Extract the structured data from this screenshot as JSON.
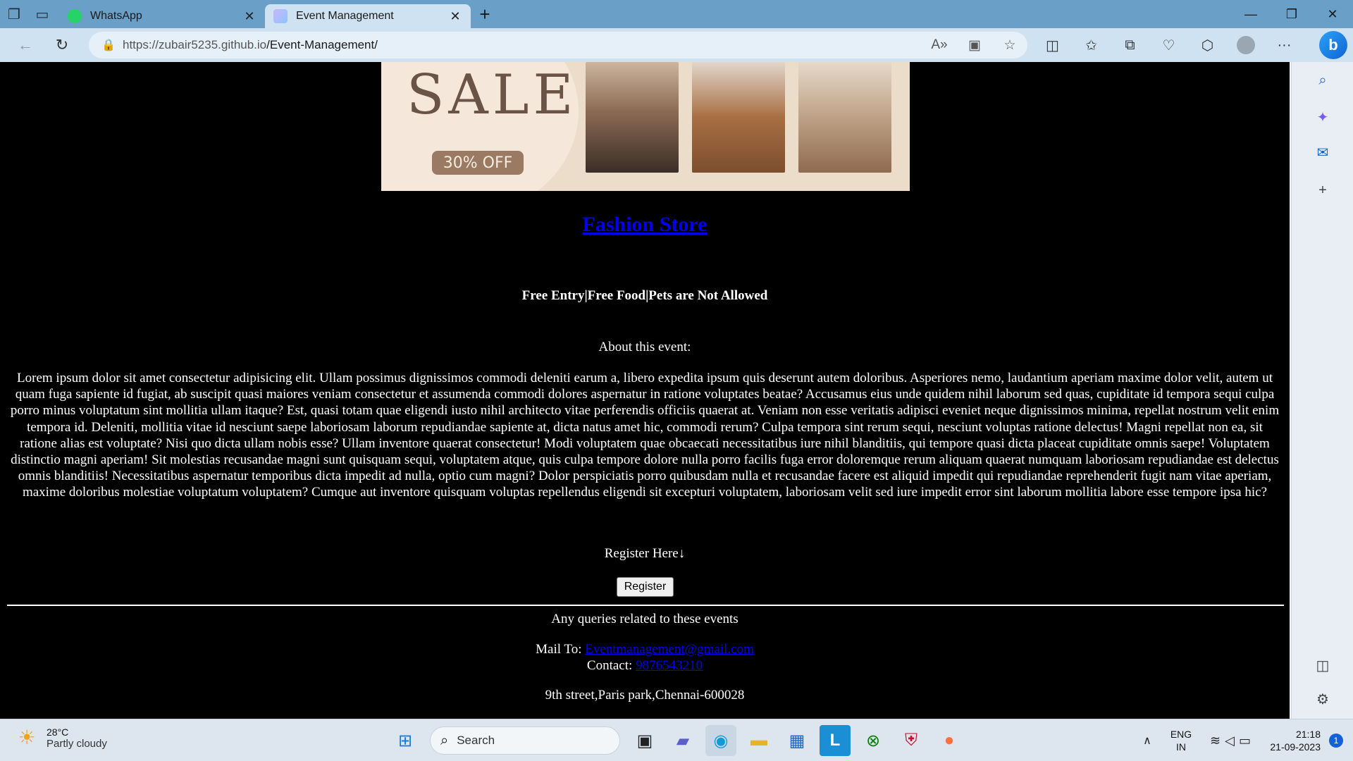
{
  "browser": {
    "tabs": [
      {
        "title": "WhatsApp",
        "active": false
      },
      {
        "title": "Event Management",
        "active": true
      }
    ],
    "url_host": "https://zubair5235.github.io",
    "url_path": "/Event-Management/"
  },
  "page": {
    "banner": {
      "headline": "SALE",
      "badge": "30% OFF"
    },
    "store_title": "Fashion Store",
    "perks": "Free Entry|Free Food|Pets are Not Allowed",
    "about_heading": "About this event:",
    "description": "Lorem ipsum dolor sit amet consectetur adipisicing elit. Ullam possimus dignissimos commodi deleniti earum a, libero expedita ipsum quis deserunt autem doloribus. Asperiores nemo, laudantium aperiam maxime dolor velit, autem ut quam fuga sapiente id fugiat, ab suscipit quasi maiores veniam consectetur et assumenda commodi dolores aspernatur in ratione voluptates beatae? Accusamus eius unde quidem nihil laborum sed quas, cupiditate id tempora sequi culpa porro minus voluptatum sint mollitia ullam itaque? Est, quasi totam quae eligendi iusto nihil architecto vitae perferendis officiis quaerat at. Veniam non esse veritatis adipisci eveniet neque dignissimos minima, repellat nostrum velit enim tempora id. Deleniti, mollitia vitae id nesciunt saepe laboriosam laborum repudiandae sapiente at, dicta natus amet hic, commodi rerum? Culpa tempora sint rerum sequi, nesciunt voluptas ratione delectus! Magni repellat non ea, sit ratione alias est voluptate? Nisi quo dicta ullam nobis esse? Ullam inventore quaerat consectetur! Modi voluptatem quae obcaecati necessitatibus iure nihil blanditiis, qui tempore quasi dicta placeat cupiditate omnis saepe! Voluptatem distinctio magni aperiam! Sit molestias recusandae magni sunt quisquam sequi, voluptatem atque, quis culpa tempore dolore nulla porro facilis fuga error doloremque rerum aliquam quaerat numquam laboriosam repudiandae est delectus omnis blanditiis! Necessitatibus aspernatur temporibus dicta impedit ad nulla, optio cum magni? Dolor perspiciatis porro quibusdam nulla et recusandae facere est aliquid impedit qui repudiandae reprehenderit fugit nam vitae aperiam, maxime doloribus molestiae voluptatum voluptatem? Cumque aut inventore quisquam voluptas repellendus eligendi sit excepturi voluptatem, laboriosam velit sed iure impedit error sint laborum mollitia labore esse tempore ipsa hic?",
    "register_prompt": "Register Here↓",
    "register_button": "Register",
    "queries_text": "Any queries related to these events",
    "mail_label": "Mail To: ",
    "mail_link": "Eventmanagement@gmail.com",
    "contact_label": "Contact: ",
    "contact_link": "9876543210",
    "address": "9th street,Paris park,Chennai-600028"
  },
  "taskbar": {
    "weather_temp": "28°C",
    "weather_cond": "Partly cloudy",
    "search_placeholder": "Search",
    "lang_1": "ENG",
    "lang_2": "IN",
    "time": "21:18",
    "date": "21-09-2023",
    "notifications": "1"
  },
  "colors": {
    "link": "#0000ee",
    "page_bg": "#000000",
    "tabbar_bg": "#6a9fc8",
    "toolbar_bg": "#cfe2f1"
  }
}
